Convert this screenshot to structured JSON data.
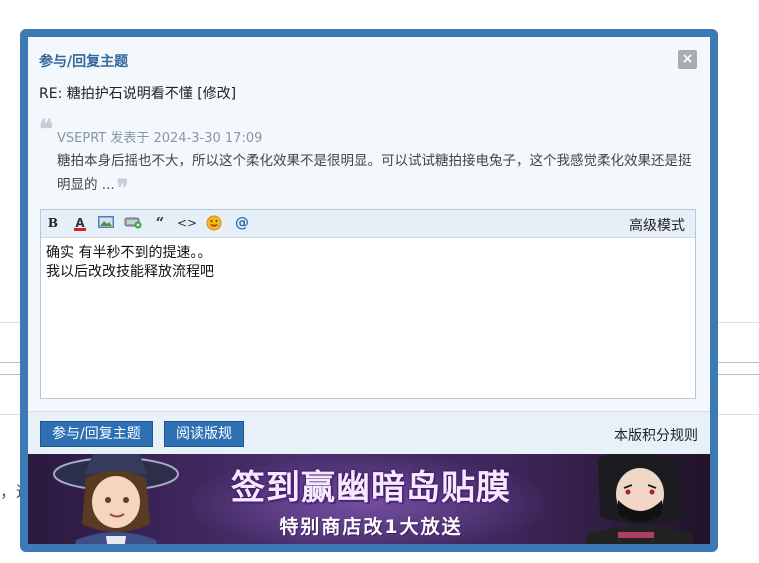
{
  "dialog": {
    "title": "参与/回复主题",
    "close_label": "×"
  },
  "subject": {
    "text": "RE: 糖拍护石说明看不懂",
    "edit_link": "[修改]"
  },
  "quote": {
    "meta": "VSEPRT 发表于 2024-3-30 17:09",
    "body": "糖拍本身后摇也不大，所以这个柔化效果不是很明显。可以试试糖拍接电兔子，这个我感觉柔化效果还是挺明显的 ..."
  },
  "editor": {
    "toolbar": {
      "bold_icon": "bold-icon",
      "color_icon": "font-color-icon",
      "image_icon": "image-icon",
      "attach_icon": "attachment-icon",
      "quote_icon": "quote-icon",
      "code_icon": "code-icon",
      "smiley_icon": "smiley-icon",
      "at_icon": "at-icon",
      "advanced_mode": "高级模式"
    },
    "content": "确实 有半秒不到的提速。。\n我以后改改技能释放流程吧"
  },
  "footer": {
    "reply_button": "参与/回复主题",
    "rules_button": "阅读版规",
    "score_rules_link": "本版积分规则"
  },
  "banner": {
    "headline": "签到赢幽暗岛贴膜",
    "subline": "特别商店改1大放送"
  },
  "background": {
    "fragment": "，这"
  },
  "colors": {
    "dialog_border": "#3c79b5",
    "title": "#336699",
    "button": "#2f6fb4"
  }
}
